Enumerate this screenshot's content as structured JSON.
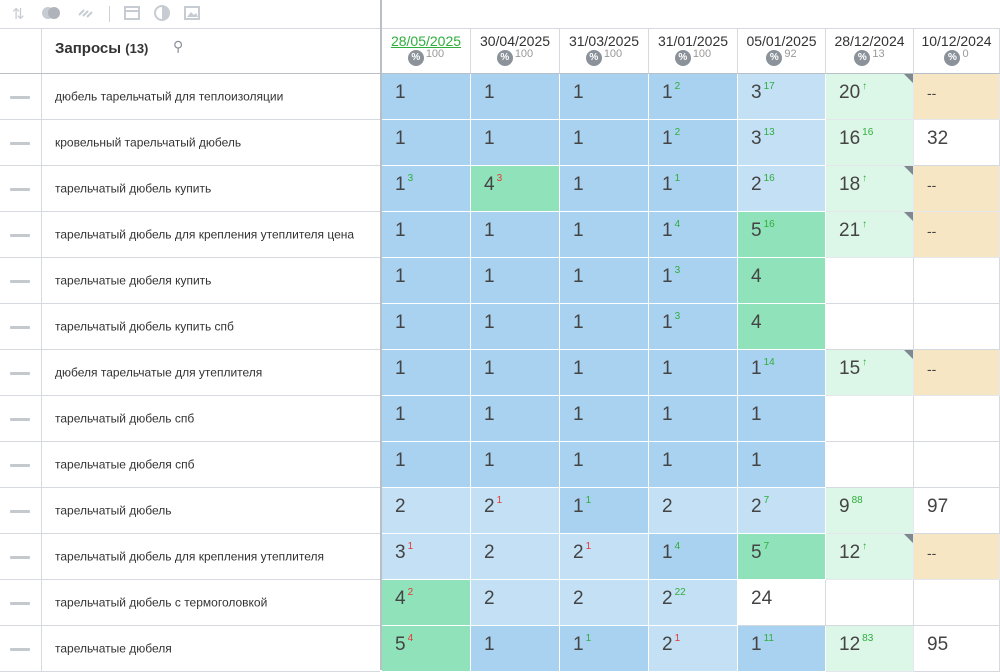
{
  "toolbar": {
    "icons": [
      "sort-icon",
      "toggle-icon",
      "link-icon",
      "table-icon",
      "contrast-icon",
      "image-icon"
    ]
  },
  "header": {
    "title": "Запросы",
    "count": "(13)"
  },
  "dates": [
    {
      "label": "28/05/2025",
      "visibility": "100",
      "active": true
    },
    {
      "label": "30/04/2025",
      "visibility": "100"
    },
    {
      "label": "31/03/2025",
      "visibility": "100"
    },
    {
      "label": "31/01/2025",
      "visibility": "100"
    },
    {
      "label": "05/01/2025",
      "visibility": "92"
    },
    {
      "label": "28/12/2024",
      "visibility": "13"
    },
    {
      "label": "10/12/2024",
      "visibility": "0"
    }
  ],
  "queries": [
    {
      "text": "дюбель тарельчатый для теплоизоляции",
      "cells": [
        {
          "v": "1",
          "c": "blue"
        },
        {
          "v": "1",
          "c": "blue"
        },
        {
          "v": "1",
          "c": "blue"
        },
        {
          "v": "1",
          "d": "2",
          "dir": "up",
          "c": "blue"
        },
        {
          "v": "3",
          "d": "17",
          "dir": "up",
          "c": "lblue"
        },
        {
          "v": "20",
          "d": "↑",
          "dir": "up",
          "c": "lgreen",
          "corner": true
        },
        {
          "v": "--",
          "c": "beige"
        }
      ]
    },
    {
      "text": "кровельный тарельчатый дюбель",
      "cells": [
        {
          "v": "1",
          "c": "blue"
        },
        {
          "v": "1",
          "c": "blue"
        },
        {
          "v": "1",
          "c": "blue"
        },
        {
          "v": "1",
          "d": "2",
          "dir": "up",
          "c": "blue"
        },
        {
          "v": "3",
          "d": "13",
          "dir": "up",
          "c": "lblue"
        },
        {
          "v": "16",
          "d": "16",
          "dir": "up",
          "c": "lgreen"
        },
        {
          "v": "32",
          "c": "white"
        }
      ]
    },
    {
      "text": "тарельчатый дюбель купить",
      "cells": [
        {
          "v": "1",
          "d": "3",
          "dir": "up",
          "c": "blue"
        },
        {
          "v": "4",
          "d": "3",
          "dir": "down",
          "c": "green"
        },
        {
          "v": "1",
          "c": "blue"
        },
        {
          "v": "1",
          "d": "1",
          "dir": "up",
          "c": "blue"
        },
        {
          "v": "2",
          "d": "16",
          "dir": "up",
          "c": "lblue"
        },
        {
          "v": "18",
          "d": "↑",
          "dir": "up",
          "c": "lgreen",
          "corner": true
        },
        {
          "v": "--",
          "c": "beige"
        }
      ]
    },
    {
      "text": "тарельчатый дюбель для крепления утеплителя цена",
      "cells": [
        {
          "v": "1",
          "c": "blue"
        },
        {
          "v": "1",
          "c": "blue"
        },
        {
          "v": "1",
          "c": "blue"
        },
        {
          "v": "1",
          "d": "4",
          "dir": "up",
          "c": "blue"
        },
        {
          "v": "5",
          "d": "16",
          "dir": "up",
          "c": "green"
        },
        {
          "v": "21",
          "d": "↑",
          "dir": "up",
          "c": "lgreen",
          "corner": true
        },
        {
          "v": "--",
          "c": "beige"
        }
      ]
    },
    {
      "text": "тарельчатые дюбеля купить",
      "cells": [
        {
          "v": "1",
          "c": "blue"
        },
        {
          "v": "1",
          "c": "blue"
        },
        {
          "v": "1",
          "c": "blue"
        },
        {
          "v": "1",
          "d": "3",
          "dir": "up",
          "c": "blue"
        },
        {
          "v": "4",
          "c": "green"
        },
        {
          "v": "",
          "c": "white"
        },
        {
          "v": "",
          "c": "white"
        }
      ]
    },
    {
      "text": "тарельчатый дюбель купить спб",
      "cells": [
        {
          "v": "1",
          "c": "blue"
        },
        {
          "v": "1",
          "c": "blue"
        },
        {
          "v": "1",
          "c": "blue"
        },
        {
          "v": "1",
          "d": "3",
          "dir": "up",
          "c": "blue"
        },
        {
          "v": "4",
          "c": "green"
        },
        {
          "v": "",
          "c": "white"
        },
        {
          "v": "",
          "c": "white"
        }
      ]
    },
    {
      "text": "дюбеля тарельчатые для утеплителя",
      "cells": [
        {
          "v": "1",
          "c": "blue"
        },
        {
          "v": "1",
          "c": "blue"
        },
        {
          "v": "1",
          "c": "blue"
        },
        {
          "v": "1",
          "c": "blue"
        },
        {
          "v": "1",
          "d": "14",
          "dir": "up",
          "c": "blue"
        },
        {
          "v": "15",
          "d": "↑",
          "dir": "up",
          "c": "lgreen",
          "corner": true
        },
        {
          "v": "--",
          "c": "beige"
        }
      ]
    },
    {
      "text": "тарельчатый дюбель спб",
      "cells": [
        {
          "v": "1",
          "c": "blue"
        },
        {
          "v": "1",
          "c": "blue"
        },
        {
          "v": "1",
          "c": "blue"
        },
        {
          "v": "1",
          "c": "blue"
        },
        {
          "v": "1",
          "c": "blue"
        },
        {
          "v": "",
          "c": "white"
        },
        {
          "v": "",
          "c": "white"
        }
      ]
    },
    {
      "text": "тарельчатые дюбеля спб",
      "cells": [
        {
          "v": "1",
          "c": "blue"
        },
        {
          "v": "1",
          "c": "blue"
        },
        {
          "v": "1",
          "c": "blue"
        },
        {
          "v": "1",
          "c": "blue"
        },
        {
          "v": "1",
          "c": "blue"
        },
        {
          "v": "",
          "c": "white"
        },
        {
          "v": "",
          "c": "white"
        }
      ]
    },
    {
      "text": "тарельчатый дюбель",
      "cells": [
        {
          "v": "2",
          "c": "lblue"
        },
        {
          "v": "2",
          "d": "1",
          "dir": "down",
          "c": "lblue"
        },
        {
          "v": "1",
          "d": "1",
          "dir": "up",
          "c": "blue"
        },
        {
          "v": "2",
          "c": "lblue"
        },
        {
          "v": "2",
          "d": "7",
          "dir": "up",
          "c": "lblue"
        },
        {
          "v": "9",
          "d": "88",
          "dir": "up",
          "c": "lgreen"
        },
        {
          "v": "97",
          "c": "white"
        }
      ]
    },
    {
      "text": "тарельчатый дюбель для крепления утеплителя",
      "cells": [
        {
          "v": "3",
          "d": "1",
          "dir": "down",
          "c": "lblue"
        },
        {
          "v": "2",
          "c": "lblue"
        },
        {
          "v": "2",
          "d": "1",
          "dir": "down",
          "c": "lblue"
        },
        {
          "v": "1",
          "d": "4",
          "dir": "up",
          "c": "blue"
        },
        {
          "v": "5",
          "d": "7",
          "dir": "up",
          "c": "green"
        },
        {
          "v": "12",
          "d": "↑",
          "dir": "up",
          "c": "lgreen",
          "corner": true
        },
        {
          "v": "--",
          "c": "beige"
        }
      ]
    },
    {
      "text": "тарельчатый дюбель с термоголовкой",
      "cells": [
        {
          "v": "4",
          "d": "2",
          "dir": "down",
          "c": "green"
        },
        {
          "v": "2",
          "c": "lblue"
        },
        {
          "v": "2",
          "c": "lblue"
        },
        {
          "v": "2",
          "d": "22",
          "dir": "up",
          "c": "lblue"
        },
        {
          "v": "24",
          "c": "white"
        },
        {
          "v": "",
          "c": "white"
        },
        {
          "v": "",
          "c": "white"
        }
      ]
    },
    {
      "text": "тарельчатые дюбеля",
      "cells": [
        {
          "v": "5",
          "d": "4",
          "dir": "down",
          "c": "green"
        },
        {
          "v": "1",
          "c": "blue"
        },
        {
          "v": "1",
          "d": "1",
          "dir": "up",
          "c": "blue"
        },
        {
          "v": "2",
          "d": "1",
          "dir": "down",
          "c": "lblue"
        },
        {
          "v": "1",
          "d": "11",
          "dir": "up",
          "c": "blue"
        },
        {
          "v": "12",
          "d": "83",
          "dir": "up",
          "c": "lgreen"
        },
        {
          "v": "95",
          "c": "white"
        }
      ]
    }
  ]
}
